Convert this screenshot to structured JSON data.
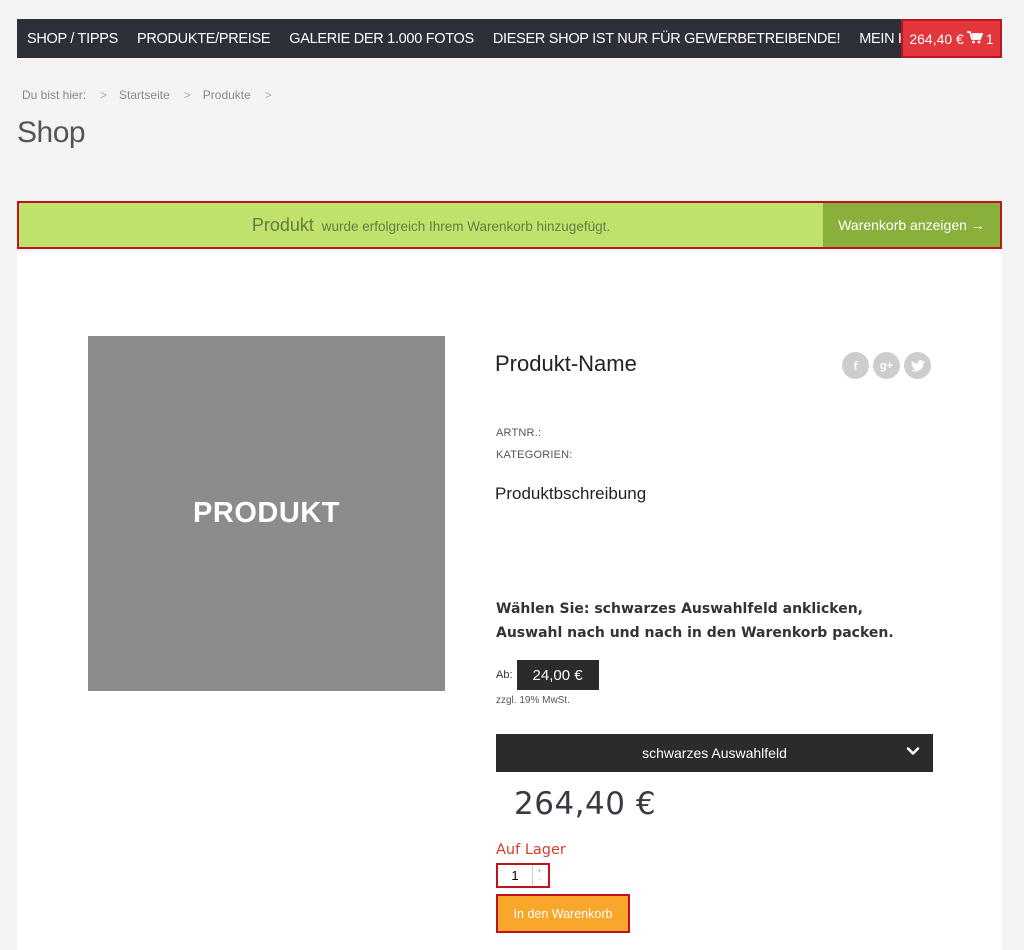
{
  "nav": {
    "items": [
      "SHOP / TIPPS",
      "PRODUKTE/PREISE",
      "GALERIE DER 1.000 FOTOS",
      "DIESER SHOP IST NUR FÜR GEWERBETREIBENDE!",
      "MEIN KONTO"
    ],
    "cart_total": "264,40 €",
    "cart_count": "1",
    "cart_icon": "shopping-cart-icon"
  },
  "breadcrumb": {
    "prefix": "Du bist hier:",
    "items": [
      "Startseite",
      "Produkte"
    ],
    "separator": ">"
  },
  "page_title": "Shop",
  "notice": {
    "product": "Produkt",
    "message": "wurde erfolgreich Ihrem Warenkorb hinzugefügt.",
    "button": "Warenkorb anzeigen →"
  },
  "product": {
    "image_label": "PRODUKT",
    "name": "Produkt-Name",
    "artnr_label": "ARTNR.:",
    "categories_label": "KATEGORIEN:",
    "description": "Produktbschreibung",
    "choose_text": "Wählen Sie: schwarzes Auswahlfeld anklicken, Auswahl nach und nach in den Warenkorb packen.",
    "price_prefix": "Ab:",
    "price": "24,00 €",
    "tax_note": "zzgl. 19% MwSt.",
    "select_label": "schwarzes Auswahlfeld",
    "total": "264,40 €",
    "stock": "Auf Lager",
    "quantity": "1",
    "add_button": "In den Warenkorb"
  },
  "social": [
    {
      "name": "facebook-icon",
      "glyph": "f"
    },
    {
      "name": "google-plus-icon",
      "glyph": "g+"
    },
    {
      "name": "twitter-icon",
      "glyph": "t"
    }
  ],
  "colors": {
    "nav_bg": "#2d3038",
    "cart_red": "#e0363c",
    "notice_green": "#bee26c",
    "notice_button": "#8ab03c",
    "add_button": "#f9a72a",
    "stock_red": "#d33f2b"
  }
}
